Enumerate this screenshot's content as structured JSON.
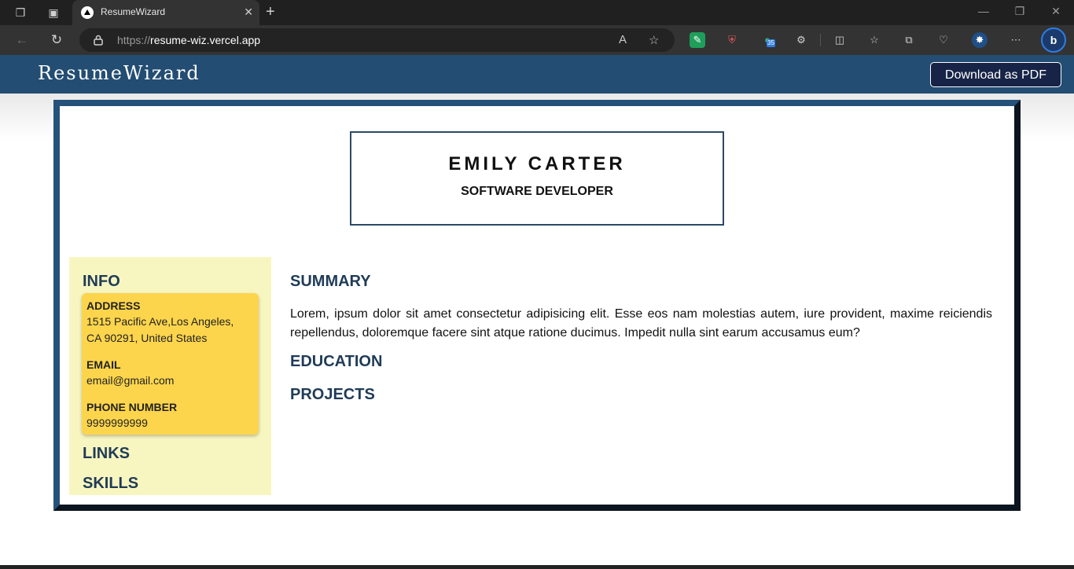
{
  "browser": {
    "tab_title": "ResumeWizard",
    "url_prefix": "https://",
    "url_host": "resume-wiz.vercel.app",
    "extension_badge": "35"
  },
  "app": {
    "brand": "ResumeWizard",
    "download_label": "Download as PDF"
  },
  "resume": {
    "name": "EMILY CARTER",
    "role": "SOFTWARE DEVELOPER",
    "sidebar": {
      "info_heading": "INFO",
      "address_label": "ADDRESS",
      "address_line1": "1515 Pacific Ave,Los Angeles,",
      "address_line2": "CA 90291, United States",
      "email_label": "EMAIL",
      "email_value": "email@gmail.com",
      "phone_label": "PHONE NUMBER",
      "phone_value": "9999999999",
      "links_heading": "LINKS",
      "skills_heading": "SKILLS"
    },
    "main": {
      "summary_heading": "SUMMARY",
      "summary_text": "Lorem, ipsum dolor sit amet consectetur adipisicing elit. Esse eos nam molestias autem, iure provident, maxime reiciendis repellendus, doloremque facere sint atque ratione ducimus. Impedit nulla sint earum accusamus eum?",
      "education_heading": "EDUCATION",
      "projects_heading": "PROJECTS"
    }
  },
  "colors": {
    "header_bg": "#234d72",
    "sidebar_bg": "#f8f6c0",
    "info_card_bg": "#fcd54c",
    "heading_color": "#1f3b57"
  }
}
